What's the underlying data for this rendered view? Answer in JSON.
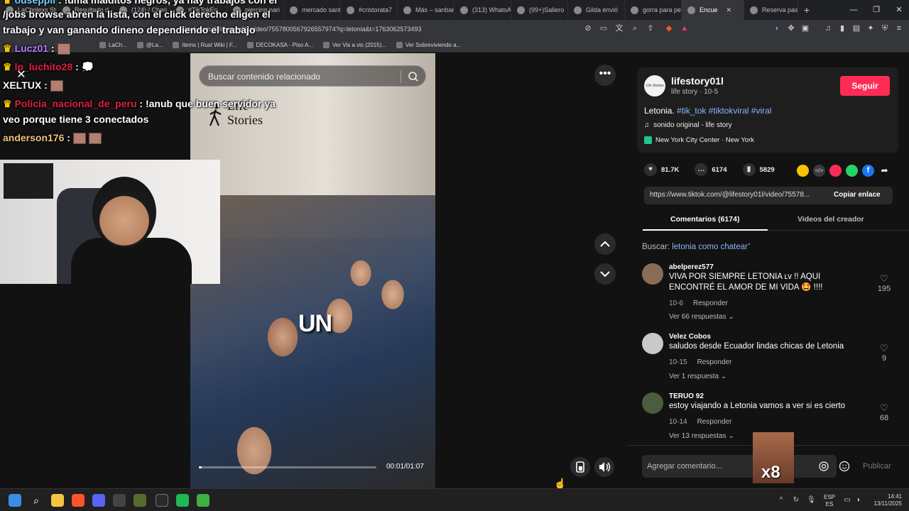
{
  "browser": {
    "tabs": [
      {
        "label": "LaCholexs St"
      },
      {
        "label": "Resultado d"
      },
      {
        "label": "(124) / Cheri"
      },
      {
        "label": "#TikTokEn"
      },
      {
        "label": "piercing nari"
      },
      {
        "label": "mercado sant"
      },
      {
        "label": "#cristorata7"
      },
      {
        "label": "Más – sanban"
      },
      {
        "label": "(313) WhatsA"
      },
      {
        "label": "(99+)Saliero"
      },
      {
        "label": "Gilda envió"
      },
      {
        "label": "gorra para pe"
      },
      {
        "label": "Encue"
      },
      {
        "label": "Reserva pasa"
      }
    ],
    "url": "tiktok.com/@lifestory01l/video/7557800567926557974?q=letonia&t=1763062573493",
    "bookmarks": [
      {
        "label": "LaCh..."
      },
      {
        "label": "@La..."
      },
      {
        "label": "Items | Rust Wiki | F..."
      },
      {
        "label": "DECOKASA - Piso A..."
      },
      {
        "label": "Ver Vis a vis (2015)..."
      },
      {
        "label": "Ver Sobreviviendo a..."
      }
    ]
  },
  "overlay": {
    "chat": [
      {
        "user": "ouseppii",
        "text": ": !uma malditos negros, ya hay trabajos con el",
        "color": "#ffffff"
      },
      {
        "user": "",
        "text": "/jobs browse abren la lista, con el click derecho eligen el",
        "color": "#ffffff"
      },
      {
        "user": "",
        "text": "trabajo y van ganando dineno dependiendo el trabajo",
        "color": "#ffffff"
      },
      {
        "user": "Lucz01",
        "text": ":",
        "color": "#b57bff"
      },
      {
        "user": "lp_luchito28",
        "text": ":",
        "color": "#e02040"
      },
      {
        "user": "XELTUX",
        "text": ":",
        "color": "#ffffff"
      },
      {
        "user": "Policia_nacional_de_peru",
        "text": ": !anub que buen servidor ya",
        "color": "#e02040"
      },
      {
        "user": "",
        "text": "veo porque tiene 3 conectados",
        "color": "#ffffff"
      },
      {
        "user": "anderson176",
        "text": ":",
        "color": "#f0c080"
      }
    ],
    "sticker_text": "x8"
  },
  "video": {
    "search_placeholder": "Buscar contenido relacionado",
    "logo_line1": "Life",
    "logo_line2": "Stories",
    "caption": "UN",
    "time": "00:01/01:07",
    "progress": 0.015
  },
  "creator": {
    "name": "lifestory01l",
    "subtitle": "life story · 10-5",
    "avatar_text": "Life Stories",
    "follow_label": "Seguir",
    "description_plain": "Letonia.",
    "hashtags": [
      "#tik_tok",
      "#tiktokviral",
      "#viral"
    ],
    "sound": "sonido original - life story",
    "place": "New York City Center · New York"
  },
  "stats": {
    "likes": "81.7K",
    "comments": "6174",
    "saves": "5829"
  },
  "link": {
    "url": "https://www.tiktok.com/@lifestory01l/video/75578...",
    "copy_label": "Copiar enlace"
  },
  "tabs": {
    "comments": "Comentarios (6174)",
    "creator_videos": "Videos del creador"
  },
  "search_hint": {
    "prefix": "Buscar:",
    "query": "letonia como chatear"
  },
  "comments": [
    {
      "user": "abelperez577",
      "text": "VIVA POR SIEMPRE LETONIA ʟᴠ !! AQUI ENCONTRÉ EL AMOR DE MI VIDA 🤩 !!!!",
      "date": "10-6",
      "reply": "Responder",
      "more": "Ver 66 respuestas ⌄",
      "likes": "195"
    },
    {
      "user": "Velez Cobos",
      "text": "saludos desde Ecuador lindas chicas de Letonia",
      "date": "10-15",
      "reply": "Responder",
      "more": "Ver 1 respuesta ⌄",
      "likes": "9"
    },
    {
      "user": "TERUO 92",
      "text": "estoy viajando a Letonia vamos a ver si es cierto",
      "date": "10-14",
      "reply": "Responder",
      "more": "Ver 13 respuestas ⌄",
      "likes": "68"
    }
  ],
  "comment_input": {
    "placeholder": "Agregar comentario...",
    "publish": "Publicar"
  },
  "taskbar": {
    "lang1": "ESP",
    "lang2": "ES",
    "time": "14:41",
    "date": "13/11/2025"
  },
  "colors": {
    "accent": "#fe2c55",
    "link": "#8ab4f8"
  }
}
